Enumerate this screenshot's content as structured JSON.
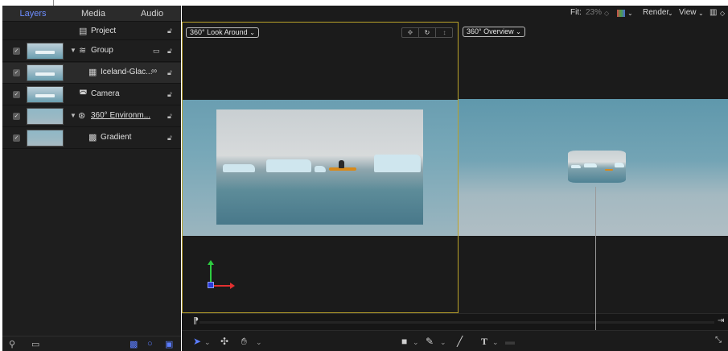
{
  "left_panel": {
    "tabs": [
      {
        "label": "Layers",
        "active": true
      },
      {
        "label": "Media",
        "active": false
      },
      {
        "label": "Audio",
        "active": false
      }
    ],
    "rows": {
      "project": {
        "label": "Project"
      },
      "group": {
        "label": "Group",
        "checked": true
      },
      "iceland": {
        "label": "Iceland-Glac...",
        "checked": true
      },
      "camera": {
        "label": "Camera",
        "checked": true
      },
      "environment": {
        "label": "360° Environm...",
        "checked": true
      },
      "gradient": {
        "label": "Gradient",
        "checked": true
      }
    },
    "check_glyph": "✓"
  },
  "toolbar": {
    "fit_label": "Fit:",
    "fit_value": "23%",
    "render_label": "Render",
    "view_label": "View"
  },
  "viewer_left": {
    "mode_label": "360° Look Around"
  },
  "viewer_right": {
    "mode_label": "360° Overview"
  },
  "colors": {
    "accent": "#6d8dff",
    "viewer_border": "#b9a12a",
    "x_axis": "#e23030",
    "y_axis": "#2ecc40",
    "z_axis": "#2a3ad8",
    "kayak": "#d88a1a"
  },
  "icons": {
    "project": "document-icon",
    "group": "layers-icon",
    "iceland": "film-icon",
    "camera": "camera-icon",
    "environment": "environment-icon",
    "gradient": "gradient-icon",
    "lock": "lock-icon"
  }
}
